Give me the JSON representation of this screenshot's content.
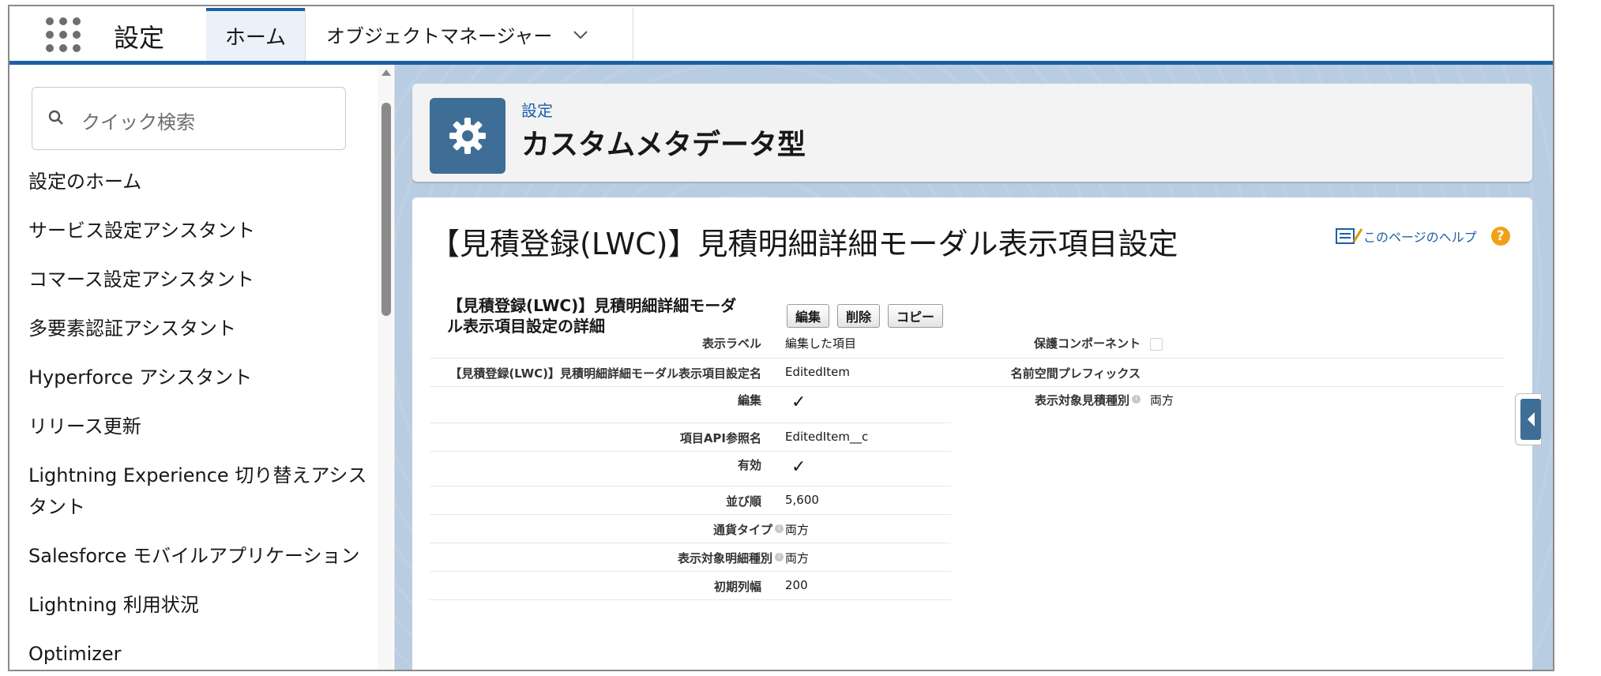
{
  "topbar": {
    "app_name": "設定",
    "tabs": [
      {
        "label": "ホーム"
      },
      {
        "label": "オブジェクトマネージャー"
      }
    ]
  },
  "sidebar": {
    "search_placeholder": "クイック検索",
    "items": [
      {
        "label": "設定のホーム"
      },
      {
        "label": "サービス設定アシスタント"
      },
      {
        "label": "コマース設定アシスタント"
      },
      {
        "label": "多要素認証アシスタント"
      },
      {
        "label": "Hyperforce アシスタント"
      },
      {
        "label": "リリース更新"
      },
      {
        "label": "Lightning Experience 切り替えアシスタント"
      },
      {
        "label": "Salesforce モバイルアプリケーション"
      },
      {
        "label": "Lightning 利用状況"
      },
      {
        "label": "Optimizer"
      }
    ]
  },
  "header": {
    "breadcrumb": "設定",
    "title": "カスタムメタデータ型"
  },
  "record": {
    "title": "【見積登録(LWC)】見積明細詳細モーダル表示項目設定",
    "help_label": "このページのヘルプ",
    "detail_title": "【見積登録(LWC)】見積明細詳細モーダル表示項目設定の詳細",
    "buttons": {
      "edit": "編集",
      "delete": "削除",
      "copy": "コピー"
    },
    "left_fields": [
      {
        "label": "表示ラベル",
        "value": "編集した項目"
      },
      {
        "label": "【見積登録(LWC)】見積明細詳細モーダル表示項目設定名",
        "value": "EditedItem"
      },
      {
        "label": "編集",
        "value": "✓"
      },
      {
        "label": "項目API参照名",
        "value": "EditedItem__c"
      },
      {
        "label": "有効",
        "value": "✓"
      },
      {
        "label": "並び順",
        "value": "5,600"
      },
      {
        "label": "通貨タイプ",
        "value": "両方"
      },
      {
        "label": "表示対象明細種別",
        "value": "両方"
      },
      {
        "label": "初期列幅",
        "value": "200"
      }
    ],
    "right_fields": [
      {
        "label": "保護コンポーネント",
        "value": ""
      },
      {
        "label": "名前空間プレフィックス",
        "value": ""
      },
      {
        "label": "表示対象見積種別",
        "value": "両方"
      }
    ]
  }
}
